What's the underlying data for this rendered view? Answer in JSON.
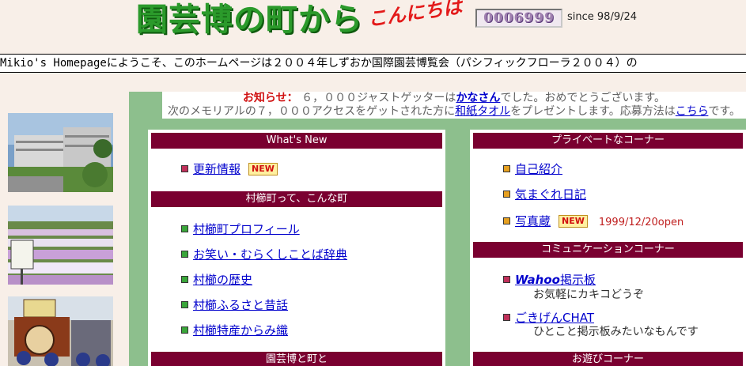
{
  "header": {
    "logo_main": "園芸博の町から",
    "logo_sub": "こんにちは",
    "counter": "0006999",
    "since": "since 98/9/24"
  },
  "marquee": {
    "text": "Mikio's Homepageにようこそ、このホームページは２００４年しずおか国際園芸博覧会（パシフィックフローラ２００４）の"
  },
  "notice": {
    "label": "お知らせ：",
    "line1_pre": "６，０００ジャストゲッターは",
    "line1_link": "かなさん",
    "line1_post": "でした。おめでとうございます。",
    "line2_pre": "次のメモリアルの７，０００アクセスをゲットされた方に",
    "line2_link": "和紙タオル",
    "line2_mid": "をプレゼントします。応募方法は",
    "line2_link2": "こちら",
    "line2_post": "です。"
  },
  "left_panel": {
    "sections": [
      {
        "title": "What's New",
        "items": [
          {
            "label": "更新情報",
            "badge": "NEW"
          }
        ]
      },
      {
        "title": "村櫛町って、こんな町",
        "items": [
          {
            "label": "村櫛町プロフィール"
          },
          {
            "label": "お笑い・むらくしことば辞典"
          },
          {
            "label": "村櫛の歴史"
          },
          {
            "label": "村櫛ふるさと昔話"
          },
          {
            "label": "村櫛特産からみ織"
          }
        ]
      },
      {
        "title": "園芸博と町と",
        "items": []
      }
    ]
  },
  "right_panel": {
    "sections": [
      {
        "title": "プライベートなコーナー",
        "items": [
          {
            "label": "自己紹介"
          },
          {
            "label": "気まぐれ日記"
          },
          {
            "label": "写真蔵",
            "badge": "NEW",
            "note": "1999/12/20open"
          }
        ]
      },
      {
        "title": "コミュニケーションコーナー",
        "items": [
          {
            "label_em": "Wahoo",
            "label": "掲示板",
            "desc": "お気軽にカキコどうぞ"
          },
          {
            "label": "ごきげんCHAT",
            "desc": "ひとこと掲示板みたいなもんです"
          }
        ]
      },
      {
        "title": "お遊びコーナー",
        "items": []
      }
    ]
  },
  "colors": {
    "background": "#f8efe8",
    "header_bar": "#7a0030",
    "main_green": "#8dbf8d",
    "logo_green": "#2b9a2b",
    "logo_red": "#e31a1a",
    "link": "#0000cc"
  }
}
